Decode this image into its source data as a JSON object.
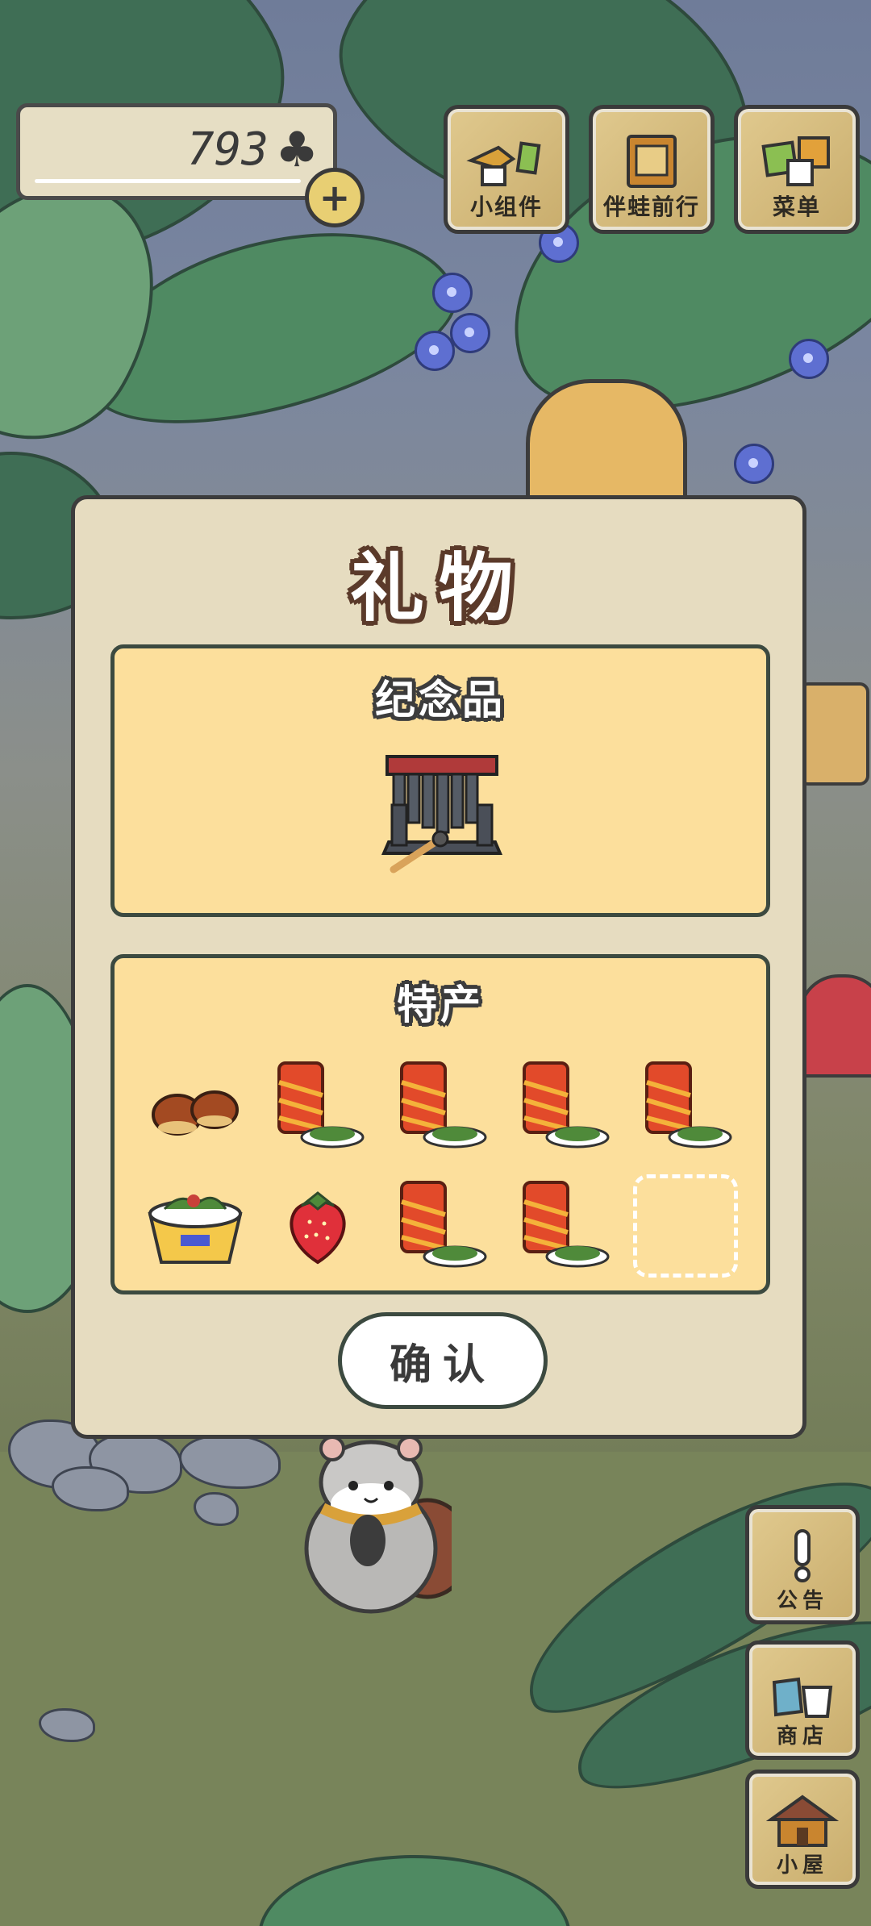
{
  "currency": {
    "amount": "793",
    "icon": "clover-icon",
    "add_icon": "plus-icon"
  },
  "top_buttons": [
    {
      "label": "小组件",
      "icon": "widget-icon"
    },
    {
      "label": "伴蛙前行",
      "icon": "journey-book-icon"
    },
    {
      "label": "菜单",
      "icon": "menu-cards-icon"
    }
  ],
  "dialog": {
    "title": "礼物",
    "souvenir": {
      "title": "纪念品",
      "item": "xylophone-icon"
    },
    "specialty": {
      "title": "特产",
      "items": [
        "chestnut-icon",
        "canned-drink-with-seaweed-icon",
        "canned-drink-with-seaweed-icon",
        "canned-drink-with-seaweed-icon",
        "canned-drink-with-seaweed-icon",
        "noodle-cup-icon",
        "strawberry-icon",
        "canned-drink-with-seaweed-icon",
        "canned-drink-with-seaweed-icon",
        "empty-slot"
      ]
    },
    "confirm_label": "确认"
  },
  "side_buttons": [
    {
      "label": "公告",
      "icon": "exclamation-icon"
    },
    {
      "label": "商店",
      "icon": "shop-bags-icon"
    },
    {
      "label": "小屋",
      "icon": "house-icon"
    }
  ],
  "colors": {
    "panel": "#fcdf9c",
    "dialog": "#e6dcc0",
    "wood": "#d8be7e",
    "outline": "#3c3c3c"
  }
}
